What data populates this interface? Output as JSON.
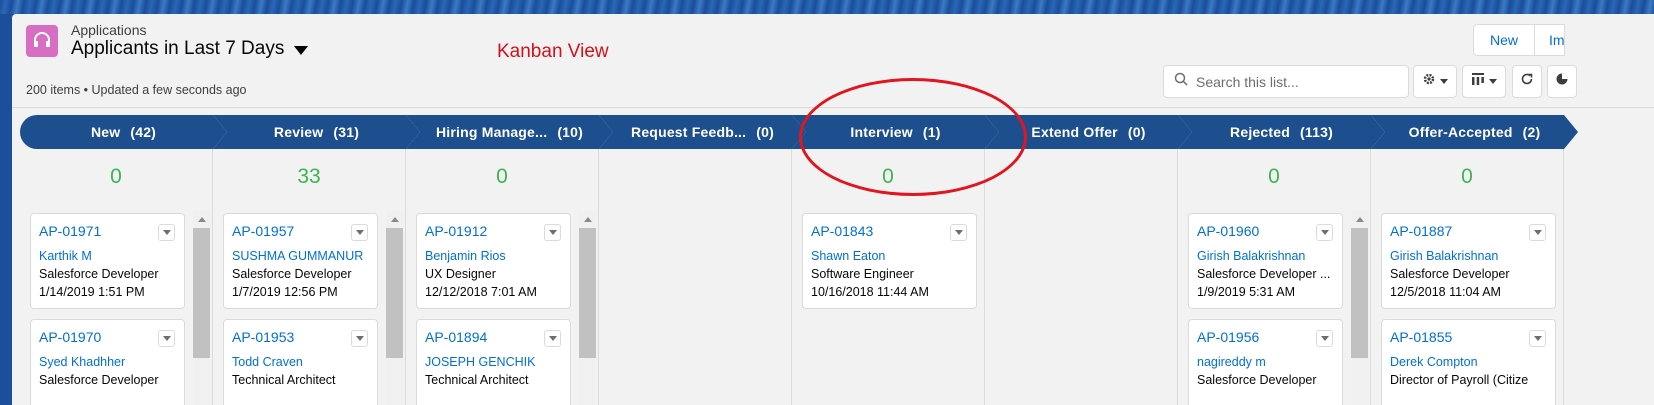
{
  "header": {
    "app_label": "Applications",
    "list_title": "Applicants in Last 7 Days",
    "meta": "200 items • Updated a few seconds ago",
    "annotation": "Kanban View"
  },
  "buttons": {
    "new_label": "New",
    "import_label": "Im"
  },
  "search": {
    "placeholder": "Search this list..."
  },
  "toolbar": {
    "icons": [
      "gear-icon",
      "column-view-icon",
      "refresh-icon",
      "chart-icon"
    ]
  },
  "colors": {
    "stage": "#1d4f8f",
    "link": "#0070d2",
    "total": "#3db352",
    "annotation": "#e0151f",
    "app_icon": "#d86ec3"
  },
  "stages": [
    {
      "label": "New",
      "count": "(42)",
      "total": "0"
    },
    {
      "label": "Review",
      "count": "(31)",
      "total": "33"
    },
    {
      "label": "Hiring Manage...",
      "count": "(10)",
      "total": "0"
    },
    {
      "label": "Request Feedb...",
      "count": "(0)",
      "total": ""
    },
    {
      "label": "Interview",
      "count": "(1)",
      "total": "0"
    },
    {
      "label": "Extend Offer",
      "count": "(0)",
      "total": ""
    },
    {
      "label": "Rejected",
      "count": "(113)",
      "total": "0"
    },
    {
      "label": "Offer-Accepted",
      "count": "(2)",
      "total": "0"
    }
  ],
  "cards": [
    [
      {
        "id": "AP-01971",
        "name": "Karthik M",
        "role": "Salesforce Developer",
        "date": "1/14/2019 1:51 PM"
      },
      {
        "id": "AP-01970",
        "name": "Syed Khadhher",
        "role": "Salesforce Developer",
        "date": ""
      }
    ],
    [
      {
        "id": "AP-01957",
        "name": "SUSHMA GUMMANUR",
        "role": "Salesforce Developer",
        "date": "1/7/2019 12:56 PM"
      },
      {
        "id": "AP-01953",
        "name": "Todd Craven",
        "role": "Technical Architect",
        "date": ""
      }
    ],
    [
      {
        "id": "AP-01912",
        "name": "Benjamin Rios",
        "role": "UX Designer",
        "date": "12/12/2018 7:01 AM"
      },
      {
        "id": "AP-01894",
        "name": "JOSEPH GENCHIK",
        "role": "Technical Architect",
        "date": ""
      }
    ],
    [],
    [
      {
        "id": "AP-01843",
        "name": "Shawn Eaton",
        "role": "Software Engineer",
        "date": "10/16/2018 11:44 AM"
      }
    ],
    [],
    [
      {
        "id": "AP-01960",
        "name": "Girish Balakrishnan",
        "role": "Salesforce Developer ...",
        "date": "1/9/2019 5:31 AM"
      },
      {
        "id": "AP-01956",
        "name": "nagireddy m",
        "role": "Salesforce Developer",
        "date": ""
      }
    ],
    [
      {
        "id": "AP-01887",
        "name": "Girish Balakrishnan",
        "role": "Salesforce Developer",
        "date": "12/5/2018 11:04 AM"
      },
      {
        "id": "AP-01855",
        "name": "Derek Compton",
        "role": "Director of Payroll (Citize",
        "date": ""
      }
    ]
  ]
}
